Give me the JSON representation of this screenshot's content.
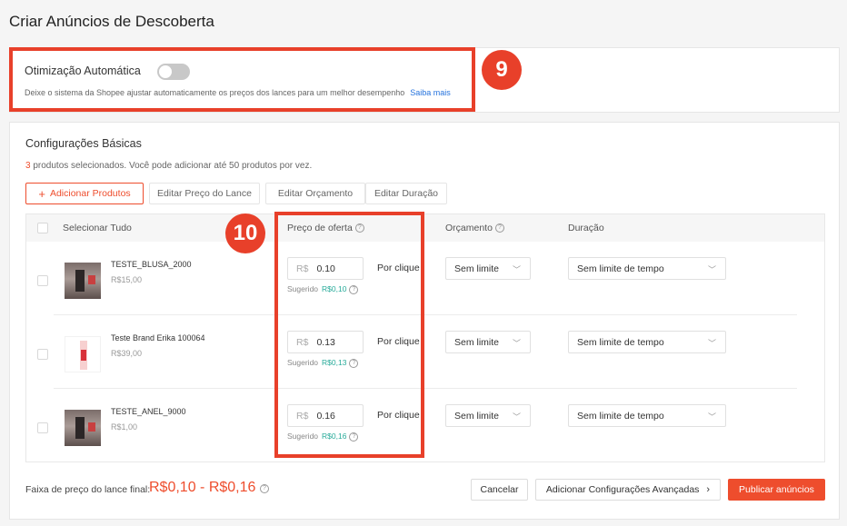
{
  "page": {
    "title": "Criar Anúncios de Descoberta"
  },
  "auto_optimization": {
    "label": "Otimização Automática",
    "enabled": false,
    "description": "Deixe o sistema da Shopee ajustar automaticamente os preços dos lances para um melhor desempenho",
    "learn_more": "Saiba mais"
  },
  "annotations": {
    "badge_9": "9",
    "badge_10": "10",
    "color": "#e8402a"
  },
  "basic": {
    "title": "Configurações Básicas",
    "selected_count": "3",
    "selected_text": " produtos selecionados. Você pode adicionar até 50 produtos por vez.",
    "buttons": {
      "add_icon": "+",
      "add": "Adicionar Produtos",
      "edit_bid": "Editar Preço do Lance",
      "edit_budget": "Editar Orçamento",
      "edit_duration": "Editar Duração"
    }
  },
  "table": {
    "headers": {
      "select_all": "Selecionar Tudo",
      "bid": "Preço de oferta",
      "budget": "Orçamento",
      "duration": "Duração",
      "help_glyph": "?"
    },
    "currency": "R$",
    "per_click": "Por clique",
    "suggested_label": "Sugerido",
    "chevron": "﹀",
    "rows": [
      {
        "name": "TESTE_BLUSA_2000",
        "price": "R$15,00",
        "thumb_icon": "room-photo",
        "bid": "0.10",
        "suggested": "R$0,10",
        "budget": "Sem limite",
        "duration": "Sem limite de tempo"
      },
      {
        "name": "Teste Brand Erika 100064",
        "price": "R$39,00",
        "thumb_icon": "bottle-photo",
        "bid": "0.13",
        "suggested": "R$0,13",
        "budget": "Sem limite",
        "duration": "Sem limite de tempo"
      },
      {
        "name": "TESTE_ANEL_9000",
        "price": "R$1,00",
        "thumb_icon": "room-photo",
        "bid": "0.16",
        "suggested": "R$0,16",
        "budget": "Sem limite",
        "duration": "Sem limite de tempo"
      }
    ]
  },
  "footer": {
    "range_label": "Faixa de preço do lance final:",
    "range_value": "R$0,10 - R$0,16",
    "cancel": "Cancelar",
    "advanced": "Adicionar Configurações Avançadas",
    "advanced_arrow": "›",
    "publish": "Publicar anúncios"
  },
  "colors": {
    "accent": "#ee4d2d",
    "link": "#2673dd",
    "suggested": "#26aa99"
  }
}
